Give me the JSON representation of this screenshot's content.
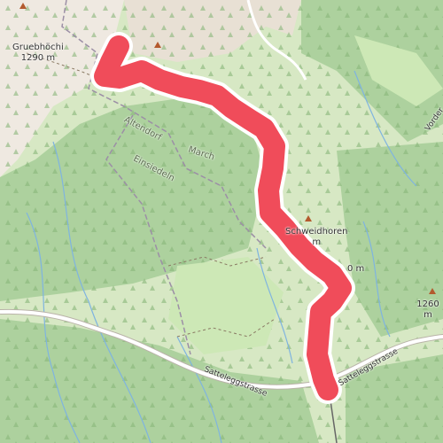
{
  "map": {
    "peaks": [
      {
        "name": "Gruebhöchi",
        "elevation": "1290 m"
      },
      {
        "name": "Schweidhoren",
        "elevation": "m"
      },
      {
        "name": "",
        "elevation": "0 m"
      },
      {
        "name": "",
        "elevation": "1260 m"
      }
    ],
    "places": [
      "Altendorf",
      "Einsiedeln",
      "March"
    ],
    "roads": [
      "Sattelegg­strasse",
      "Sattelegg­strasse",
      "Vorder"
    ],
    "colors": {
      "forest": "#add19e",
      "meadow": "#cde8b6",
      "rock": "#efe9e1",
      "route": "#f04c5a",
      "road": "#ffffff",
      "water": "#7fb4e0",
      "boundary": "#9c8fa6"
    }
  }
}
